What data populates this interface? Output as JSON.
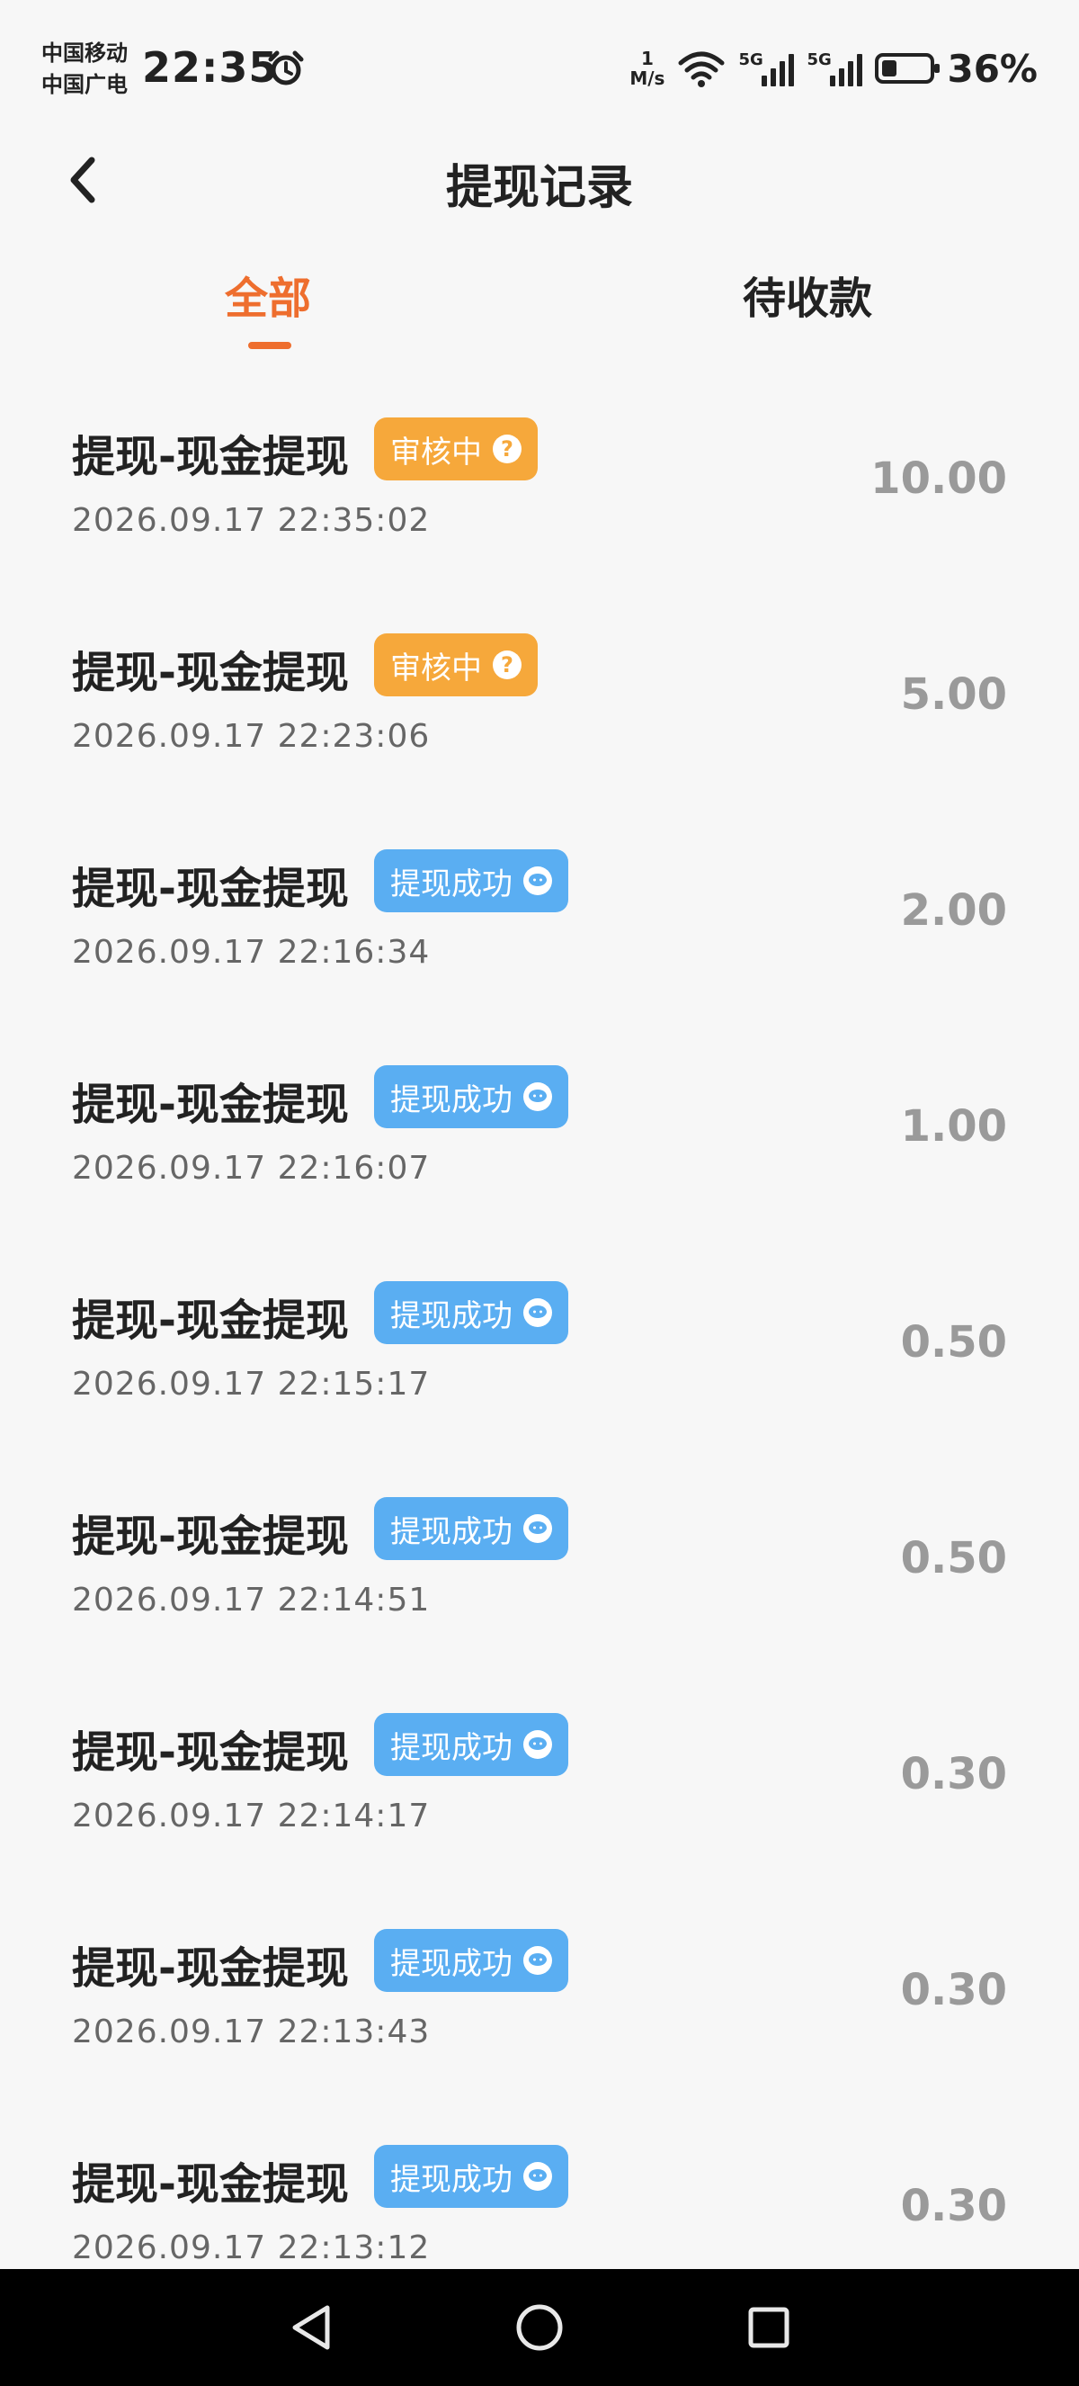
{
  "status_bar": {
    "carrier_1": "中国移动",
    "carrier_2": "中国广电",
    "time": "22:35",
    "speed_value": "1",
    "speed_unit": "M/s",
    "signal_1_label": "5G",
    "signal_2_label": "5G",
    "battery": "36%",
    "battery_level": 0.36
  },
  "header": {
    "title": "提现记录"
  },
  "tabs": [
    {
      "label": "全部",
      "active": true
    },
    {
      "label": "待收款",
      "active": false
    }
  ],
  "records": [
    {
      "title": "提现-现金提现",
      "status": "审核中",
      "status_type": "review",
      "status_icon": "?",
      "time": "2026.09.17 22:35:02",
      "amount": "10.00"
    },
    {
      "title": "提现-现金提现",
      "status": "审核中",
      "status_type": "review",
      "status_icon": "?",
      "time": "2026.09.17 22:23:06",
      "amount": "5.00"
    },
    {
      "title": "提现-现金提现",
      "status": "提现成功",
      "status_type": "success",
      "status_icon": "wechat-icon",
      "time": "2026.09.17 22:16:34",
      "amount": "2.00"
    },
    {
      "title": "提现-现金提现",
      "status": "提现成功",
      "status_type": "success",
      "status_icon": "wechat-icon",
      "time": "2026.09.17 22:16:07",
      "amount": "1.00"
    },
    {
      "title": "提现-现金提现",
      "status": "提现成功",
      "status_type": "success",
      "status_icon": "wechat-icon",
      "time": "2026.09.17 22:15:17",
      "amount": "0.50"
    },
    {
      "title": "提现-现金提现",
      "status": "提现成功",
      "status_type": "success",
      "status_icon": "wechat-icon",
      "time": "2026.09.17 22:14:51",
      "amount": "0.50"
    },
    {
      "title": "提现-现金提现",
      "status": "提现成功",
      "status_type": "success",
      "status_icon": "wechat-icon",
      "time": "2026.09.17 22:14:17",
      "amount": "0.30"
    },
    {
      "title": "提现-现金提现",
      "status": "提现成功",
      "status_type": "success",
      "status_icon": "wechat-icon",
      "time": "2026.09.17 22:13:43",
      "amount": "0.30"
    },
    {
      "title": "提现-现金提现",
      "status": "提现成功",
      "status_type": "success",
      "status_icon": "wechat-icon",
      "time": "2026.09.17 22:13:12",
      "amount": "0.30"
    }
  ],
  "colors": {
    "accent": "#ee6e2e",
    "review_badge": "#f6a83b",
    "success_badge": "#5aaef2",
    "background": "#f7f7f7"
  },
  "navbar": {
    "buttons": [
      "back-icon",
      "home-icon",
      "recents-icon"
    ]
  }
}
